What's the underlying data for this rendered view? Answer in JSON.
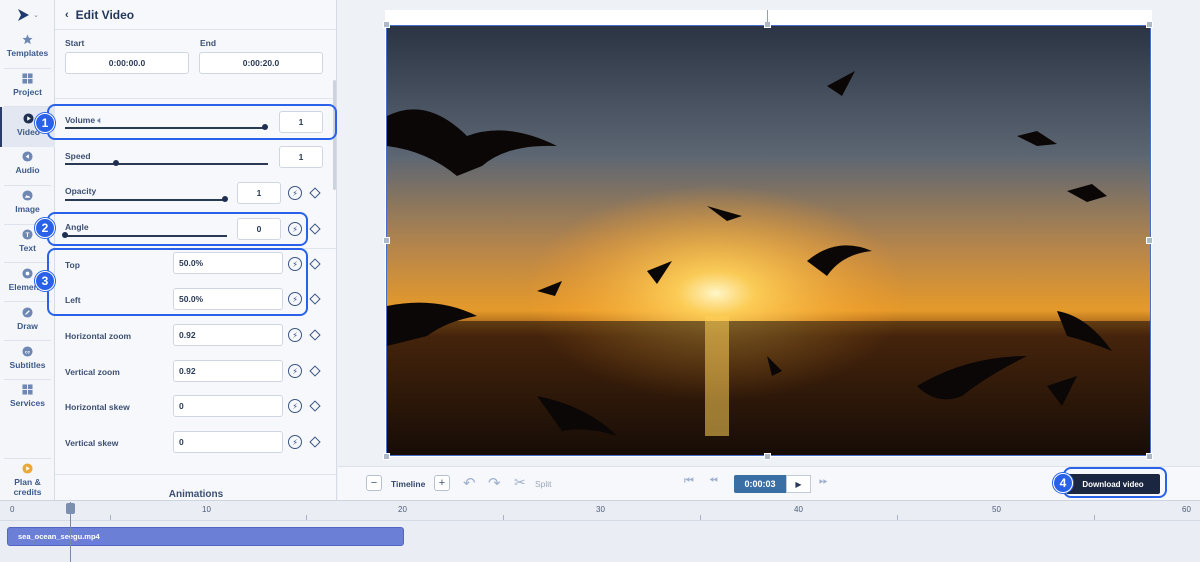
{
  "sidebar": {
    "items": [
      {
        "label": "Templates",
        "icon": "star-icon"
      },
      {
        "label": "Project",
        "icon": "grid-icon"
      },
      {
        "label": "Video",
        "icon": "play-circle-icon"
      },
      {
        "label": "Audio",
        "icon": "audio-icon"
      },
      {
        "label": "Image",
        "icon": "image-icon"
      },
      {
        "label": "Text",
        "icon": "text-icon"
      },
      {
        "label": "Elements",
        "icon": "elements-icon"
      },
      {
        "label": "Draw",
        "icon": "pencil-icon"
      },
      {
        "label": "Subtitles",
        "icon": "cc-icon"
      },
      {
        "label": "Services",
        "icon": "services-icon"
      },
      {
        "label": "Plan & credits",
        "icon": "plan-icon"
      }
    ]
  },
  "edit_panel": {
    "title": "Edit Video",
    "start_label": "Start",
    "start_value": "0:00:00.0",
    "end_label": "End",
    "end_value": "0:00:20.0",
    "volume_label": "Volume",
    "volume_value": "1",
    "volume_fraction": 1.0,
    "speed_label": "Speed",
    "speed_value": "1",
    "speed_fraction": 0.25,
    "opacity_label": "Opacity",
    "opacity_value": "1",
    "opacity_fraction": 1.0,
    "angle_label": "Angle",
    "angle_value": "0",
    "angle_fraction": 0.0,
    "top_label": "Top",
    "top_value": "50.0%",
    "left_label": "Left",
    "left_value": "50.0%",
    "hzoom_label": "Horizontal zoom",
    "hzoom_value": "0.92",
    "vzoom_label": "Vertical zoom",
    "vzoom_value": "0.92",
    "hskew_label": "Horizontal skew",
    "hskew_value": "0",
    "vskew_label": "Vertical skew",
    "vskew_value": "0",
    "animations_label": "Animations"
  },
  "callouts": [
    "1",
    "2",
    "3",
    "4"
  ],
  "controls": {
    "timeline_label": "Timeline",
    "split_label": "Split",
    "current_time": "0:00:03",
    "download_label": "Download video"
  },
  "timeline": {
    "ticks": [
      "0",
      "10",
      "20",
      "30",
      "40",
      "50",
      "60"
    ],
    "clip_name": "sea_ocean_seegu.mp4"
  },
  "colors": {
    "accent": "#2962e8",
    "dark": "#1b2740",
    "clip": "#6c7fd6"
  }
}
